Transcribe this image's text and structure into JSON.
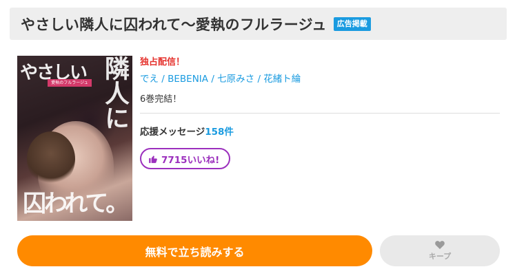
{
  "header": {
    "title": "やさしい隣人に囚われて～愛執のフルラージュ",
    "ad_badge": "広告掲載"
  },
  "cover": {
    "title_text": "やさしい",
    "big_text": "隣人に",
    "sub_text": "愛執のフルラージュ",
    "bottom_text": "囚われて。"
  },
  "book": {
    "exclusive_label": "独占配信！",
    "authors": "でえ / BEBENIA / 七原みさ / 花緒ト綸",
    "status": "6巻完結！",
    "support_label": "応援メッセージ",
    "support_count": "158件",
    "like_label": "7715いいね!"
  },
  "actions": {
    "read_label": "無料で立ち読みする",
    "keep_label": "キープ"
  },
  "colors": {
    "accent_blue": "#1a9be0",
    "exclusive_red": "#e5322d",
    "like_purple": "#9b2fbd",
    "read_orange": "#ff8a00",
    "keep_gray": "#e9e9e9"
  },
  "icons": {
    "like": "thumbs-up-icon",
    "keep": "heart-icon"
  }
}
